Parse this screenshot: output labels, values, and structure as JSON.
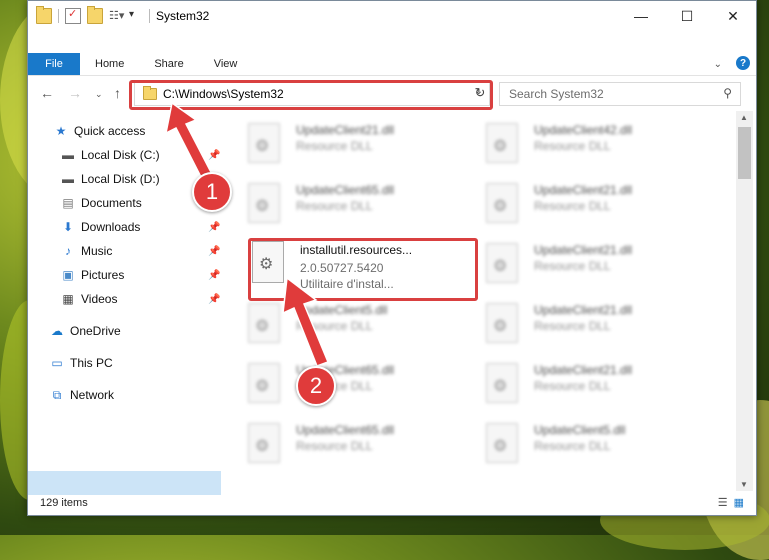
{
  "window": {
    "title": "System32",
    "caption": {
      "minimize": "—",
      "maximize": "☐",
      "close": "✕"
    }
  },
  "ribbon": {
    "file": "File",
    "tabs": [
      "Home",
      "Share",
      "View"
    ],
    "help": "?"
  },
  "address": {
    "path": "C:\\Windows\\System32"
  },
  "search": {
    "placeholder": "Search System32"
  },
  "sidebar": {
    "items": [
      {
        "label": "Quick access",
        "icon": "star-icon",
        "pinned": false
      },
      {
        "label": "Local Disk (C:)",
        "icon": "drive-icon",
        "pinned": true
      },
      {
        "label": "Local Disk (D:)",
        "icon": "drive-icon",
        "pinned": false
      },
      {
        "label": "Documents",
        "icon": "documents-icon",
        "pinned": false
      },
      {
        "label": "Downloads",
        "icon": "download-icon",
        "pinned": true
      },
      {
        "label": "Music",
        "icon": "music-icon",
        "pinned": true
      },
      {
        "label": "Pictures",
        "icon": "pictures-icon",
        "pinned": true
      },
      {
        "label": "Videos",
        "icon": "videos-icon",
        "pinned": true
      },
      {
        "label": "OneDrive",
        "icon": "cloud-icon",
        "pinned": false
      },
      {
        "label": "This PC",
        "icon": "computer-icon",
        "pinned": false
      },
      {
        "label": "Network",
        "icon": "network-icon",
        "pinned": false
      }
    ]
  },
  "files": {
    "left": [
      {
        "name": "UpdateClient21.dll",
        "type": "Resource DLL"
      },
      {
        "name": "UpdateClient65.dll",
        "type": "Resource DLL"
      },
      {
        "name": "UpdateClient5.dll",
        "type": "Resource DLL"
      },
      {
        "name": "UpdateClient65.dll",
        "type": "Resource DLL"
      },
      {
        "name": "UpdateClient65.dll",
        "type": "Resource DLL"
      }
    ],
    "right": [
      {
        "name": "UpdateClient42.dll",
        "type": "Resource DLL"
      },
      {
        "name": "UpdateClient21.dll",
        "type": "Resource DLL"
      },
      {
        "name": "UpdateClient21.dll",
        "type": "Resource DLL"
      },
      {
        "name": "UpdateClient21.dll",
        "type": "Resource DLL"
      },
      {
        "name": "UpdateClient21.dll",
        "type": "Resource DLL"
      },
      {
        "name": "UpdateClient21.dll",
        "type": "Resource DLL"
      },
      {
        "name": "UpdateClient5.dll",
        "type": "Resource DLL"
      }
    ],
    "highlighted": {
      "name": "installutil.resources...",
      "version": "2.0.50727.5420",
      "description": "Utilitaire d'instal..."
    }
  },
  "status": {
    "count": "129 items"
  },
  "markers": [
    "1",
    "2"
  ],
  "colors": {
    "accent": "#1979ca",
    "highlight": "#d94040",
    "selection": "#cce4f7"
  }
}
